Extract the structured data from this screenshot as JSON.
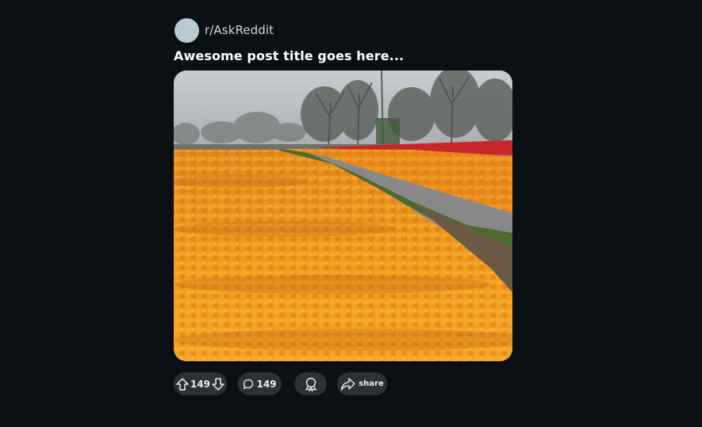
{
  "post": {
    "subreddit": "r/AskReddit",
    "title": "Awesome post title goes here...",
    "image": {
      "subject": "tulip field photo",
      "alt": ""
    }
  },
  "actions": {
    "vote_count": "149",
    "comment_count": "149",
    "share_label": "share"
  },
  "icons": {
    "upvote": "upvote-arrow-icon",
    "downvote": "downvote-arrow-icon",
    "comment": "comment-bubble-icon",
    "award": "award-icon",
    "share": "share-arrow-icon"
  },
  "colors": {
    "background": "#0b1014",
    "pill": "#2a3236",
    "avatar": "#b7c9d3",
    "text": "#ffffff"
  }
}
